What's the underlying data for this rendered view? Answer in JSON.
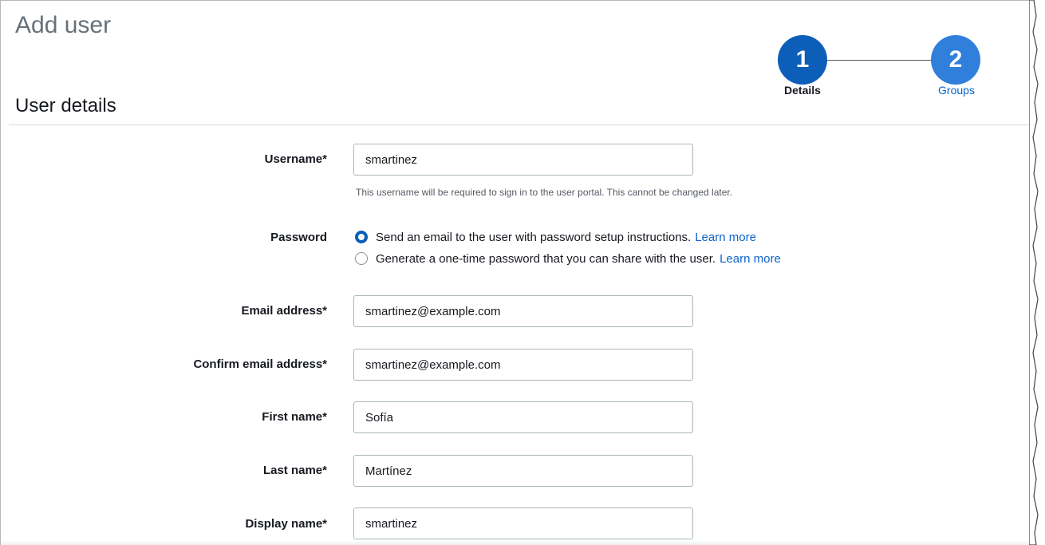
{
  "header": {
    "title": "Add user",
    "section_title": "User details"
  },
  "stepper": {
    "steps": [
      {
        "number": "1",
        "label": "Details",
        "state": "current"
      },
      {
        "number": "2",
        "label": "Groups",
        "state": "next"
      }
    ]
  },
  "form": {
    "username": {
      "label": "Username*",
      "value": "smartinez",
      "hint": "This username will be required to sign in to the user portal. This cannot be changed later."
    },
    "password": {
      "label": "Password",
      "options": [
        {
          "text": "Send an email to the user with password setup instructions.",
          "link": "Learn more",
          "selected": true
        },
        {
          "text": "Generate a one-time password that you can share with the user.",
          "link": "Learn more",
          "selected": false
        }
      ]
    },
    "email": {
      "label": "Email address*",
      "value": "smartinez@example.com"
    },
    "confirm_email": {
      "label": "Confirm email address*",
      "value": "smartinez@example.com"
    },
    "first_name": {
      "label": "First name*",
      "value": "Sofía"
    },
    "last_name": {
      "label": "Last name*",
      "value": "Martínez"
    },
    "display_name": {
      "label": "Display name*",
      "value": "smartinez"
    }
  },
  "colors": {
    "primary_step": "#0d5eb8",
    "secondary_step": "#2f7fdb",
    "link": "#0c63c9"
  }
}
